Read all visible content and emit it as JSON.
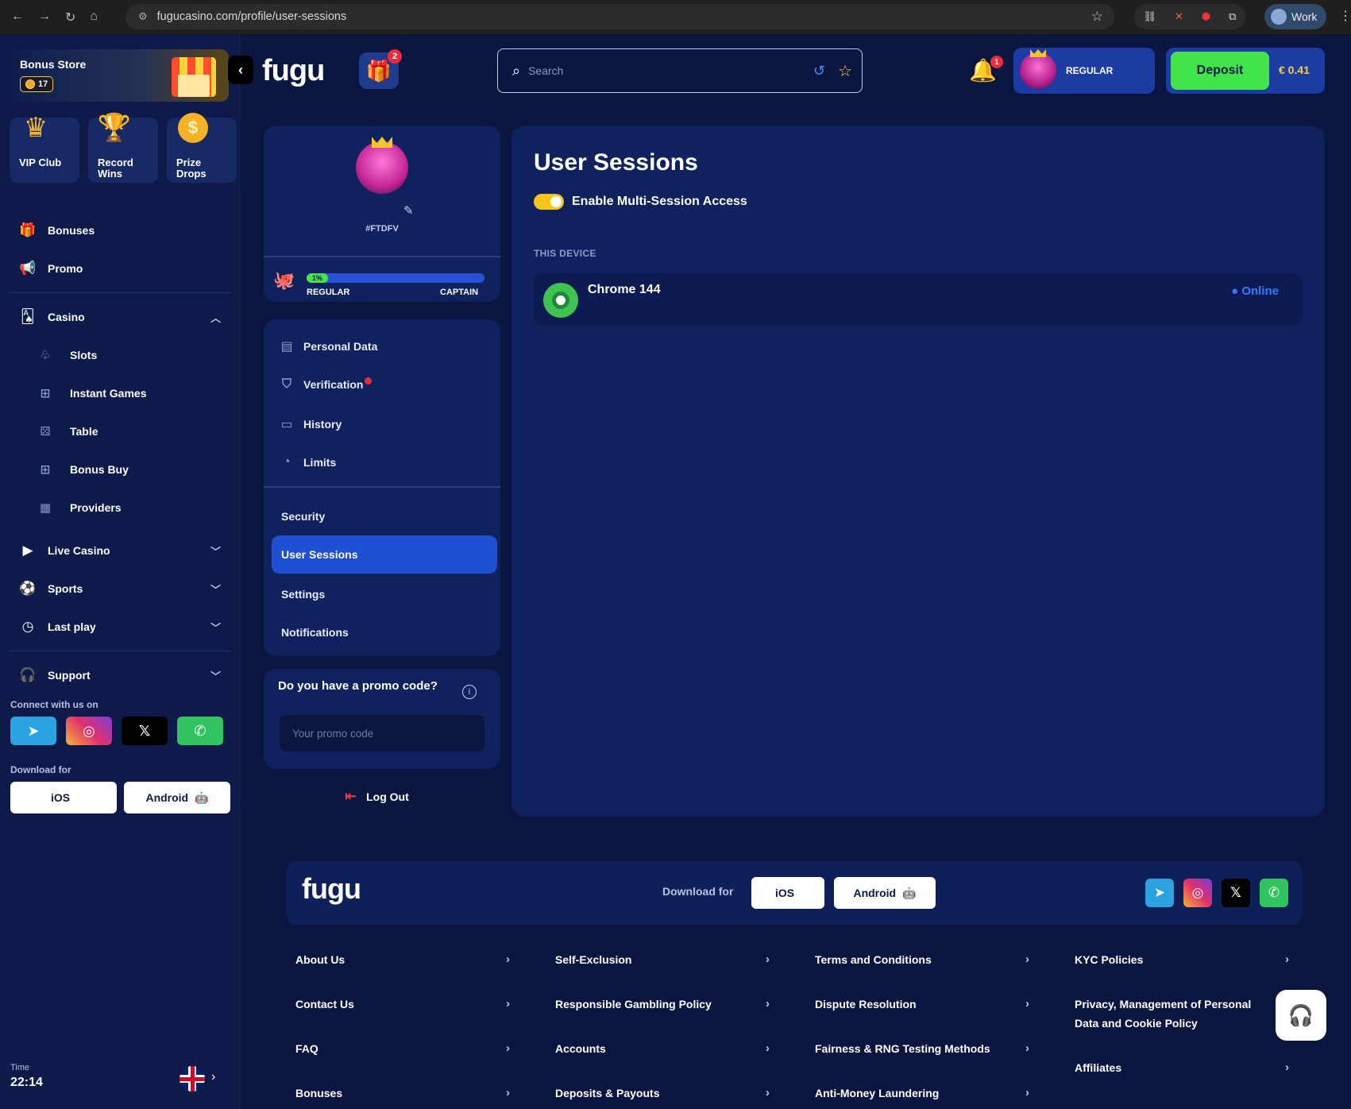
{
  "browser": {
    "url": "fugucasino.com/profile/user-sessions",
    "profile_label": "Work"
  },
  "sidebar": {
    "bonus_store": {
      "title": "Bonus Store",
      "coins": "17"
    },
    "tiles": [
      {
        "label": "VIP Club"
      },
      {
        "label": "Record Wins"
      },
      {
        "label": "Prize Drops"
      }
    ],
    "top_items": [
      {
        "label": "Bonuses"
      },
      {
        "label": "Promo"
      }
    ],
    "casino": {
      "label": "Casino",
      "children": [
        {
          "label": "Slots"
        },
        {
          "label": "Instant Games"
        },
        {
          "label": "Table"
        },
        {
          "label": "Bonus Buy"
        },
        {
          "label": "Providers"
        }
      ]
    },
    "groups": [
      {
        "label": "Live Casino"
      },
      {
        "label": "Sports"
      },
      {
        "label": "Last play"
      }
    ],
    "support": "Support",
    "connect_label": "Connect with us on",
    "download_label": "Download for",
    "ios": "iOS",
    "android": "Android",
    "time_label": "Time",
    "time_value": "22:14"
  },
  "header": {
    "logo": "fugu",
    "gift_count": "2",
    "search_placeholder": "Search",
    "notification_count": "1",
    "rank": "REGULAR",
    "deposit": "Deposit",
    "balance": "€ 0.41"
  },
  "profile": {
    "id": "#FTDFV",
    "progress_label": "1%",
    "progress": 0.01,
    "rank_current": "REGULAR",
    "rank_next": "CAPTAIN",
    "menu": [
      {
        "label": "Personal Data"
      },
      {
        "label": "Verification"
      },
      {
        "label": "History"
      },
      {
        "label": "Limits"
      },
      {
        "label": "Security"
      },
      {
        "label": "User Sessions"
      },
      {
        "label": "Settings"
      },
      {
        "label": "Notifications"
      }
    ],
    "promo_question": "Do you have a promo code?",
    "promo_placeholder": "Your promo code",
    "logout": "Log Out"
  },
  "main": {
    "title": "User Sessions",
    "toggle_label": "Enable Multi-Session Access",
    "section": "THIS DEVICE",
    "session_name": "Chrome 144",
    "session_status": "Online"
  },
  "footer": {
    "logo": "fugu",
    "download_label": "Download for",
    "ios": "iOS",
    "android": "Android",
    "links": [
      [
        "About Us",
        "Contact Us",
        "FAQ",
        "Bonuses"
      ],
      [
        "Self-Exclusion",
        "Responsible Gambling Policy",
        "Accounts",
        "Deposits & Payouts"
      ],
      [
        "Terms and Conditions",
        "Dispute Resolution",
        "Fairness & RNG Testing Methods",
        "Anti-Money Laundering"
      ],
      [
        "KYC Policies",
        "Privacy, Management of Personal Data and Cookie Policy",
        "Affiliates"
      ]
    ]
  }
}
